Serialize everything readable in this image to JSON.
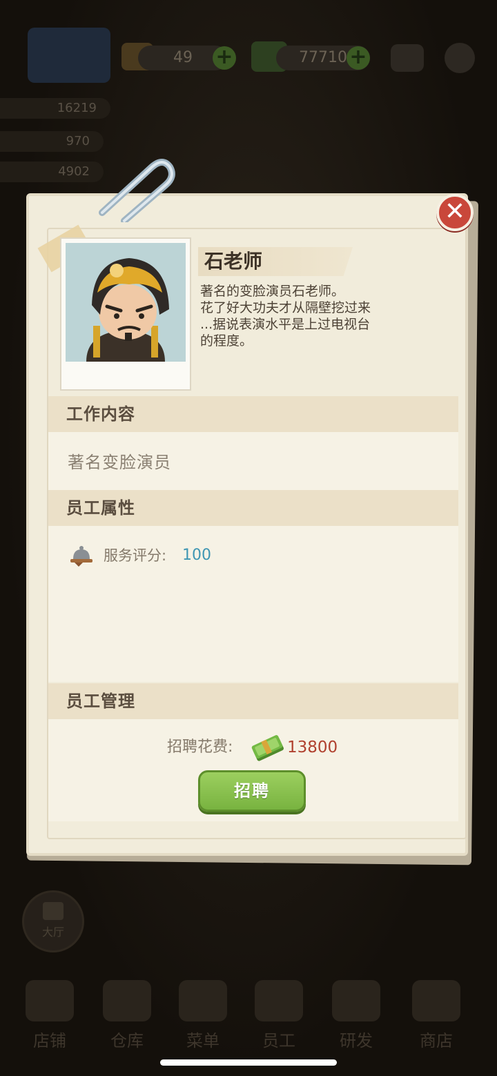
{
  "topbar": {
    "gems": "49",
    "cash": "77710"
  },
  "side_stats": {
    "stat1": "16219",
    "stat2": "970",
    "stat3": "4902"
  },
  "hall_button_label": "大厅",
  "bottom_nav": [
    "店铺",
    "仓库",
    "菜单",
    "员工",
    "研发",
    "商店"
  ],
  "dialog": {
    "name": "石老师",
    "description": [
      "著名的变脸演员石老师。",
      "花了好大功夫才从隔壁挖过来",
      "...据说表演水平是上过电视台",
      "的程度。"
    ],
    "sections": {
      "work_title": "工作内容",
      "work_content": "著名变脸演员",
      "attr_title": "员工属性",
      "attr_label": "服务评分:",
      "attr_value": "100",
      "manage_title": "员工管理",
      "cost_label": "招聘花费:",
      "cost_value": "13800",
      "hire_label": "招聘"
    },
    "close_icon": "close-icon",
    "colors": {
      "accent_green": "#78b340",
      "close_red": "#c9473a",
      "value_blue": "#3e96b3",
      "cost_red": "#b0412f"
    }
  }
}
